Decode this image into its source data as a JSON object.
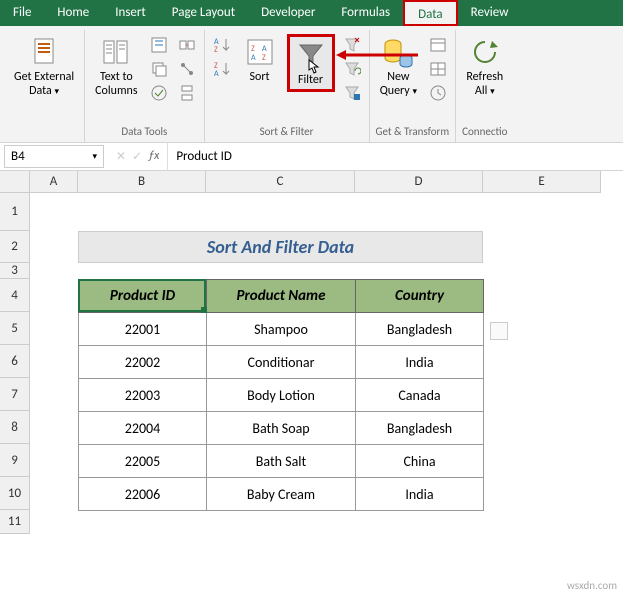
{
  "tabs": [
    "File",
    "Home",
    "Insert",
    "Page Layout",
    "Developer",
    "Formulas",
    "Data",
    "Review"
  ],
  "active_tab": "Data",
  "ribbon": {
    "get_external": {
      "label": "Get External\nData",
      "dd": "▾"
    },
    "text_to_cols": {
      "label": "Text to\nColumns"
    },
    "group_data_tools": "Data Tools",
    "sort": "Sort",
    "filter": "Filter",
    "group_sort_filter": "Sort & Filter",
    "new_query": {
      "label": "New\nQuery",
      "dd": "▾"
    },
    "group_get_transform": "Get & Transform",
    "refresh": {
      "label": "Refresh\nAll",
      "dd": "▾"
    },
    "group_connections": "Connectio"
  },
  "namebox": "B4",
  "fx_label": "ƒx",
  "formula": "Product ID",
  "cols": {
    "A": "A",
    "B": "B",
    "C": "C",
    "D": "D",
    "E": "E"
  },
  "rows": [
    "1",
    "2",
    "3",
    "4",
    "5",
    "6",
    "7",
    "8",
    "9",
    "10",
    "11"
  ],
  "title": "Sort And Filter Data",
  "headers": [
    "Product ID",
    "Product Name",
    "Country"
  ],
  "table_data": [
    [
      "22001",
      "Shampoo",
      "Bangladesh"
    ],
    [
      "22002",
      "Conditionar",
      "India"
    ],
    [
      "22003",
      "Body Lotion",
      "Canada"
    ],
    [
      "22004",
      "Bath Soap",
      "Bangladesh"
    ],
    [
      "22005",
      "Bath Salt",
      "China"
    ],
    [
      "22006",
      "Baby Cream",
      "India"
    ]
  ],
  "watermark": "wsxdn.com"
}
